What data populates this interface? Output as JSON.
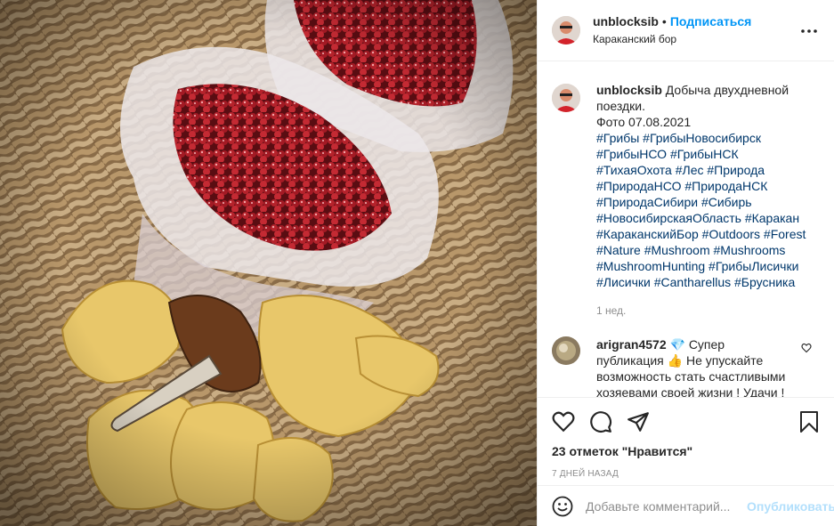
{
  "post": {
    "username": "unblocksib",
    "follow_label": "Подписаться",
    "separator": "•",
    "location": "Караканский бор",
    "more_label": "•••"
  },
  "caption": {
    "username": "unblocksib",
    "text_line1": "Добыча двухдневной",
    "text_line2": "поездки.",
    "text_line3": "Фото 07.08.2021",
    "hashtags": [
      "#Грибы #ГрибыНовосибирск",
      "#ГрибыНСО #ГрибыНСК",
      "#ТихаяОхота #Лес #Природа",
      "#ПриродаНСО #ПриродаНСК",
      "#ПриродаСибири #Сибирь",
      "#НовосибирскаяОбласть #Каракан",
      "#КараканскийБор #Outdoors #Forest",
      "#Nature #Mushroom #Mushrooms",
      "#MushroomHunting #ГрибыЛисички",
      "#Лисички #Cantharellus #Брусника"
    ],
    "time_ago": "1 нед."
  },
  "comment": {
    "username": "arigran4572",
    "text_line1": "💎 Супер",
    "text_line2": "публикация 👍 Не упускайте",
    "text_line3": "возможность стать счастливыми",
    "text_line4": "хозяевами своей жизни ! Удачи !"
  },
  "actions": {
    "likes_text": "23 отметок \"Нравится\"",
    "date_text": "7 дней назад"
  },
  "add_comment": {
    "placeholder": "Добавьте комментарий...",
    "publish_label": "Опубликовать"
  },
  "colors": {
    "link_blue": "#0095f6",
    "hashtag_blue": "#00376b",
    "muted_gray": "#8e8e8e",
    "publish_disabled": "#b2dffc"
  },
  "icons": [
    "more-icon",
    "heart-icon",
    "comment-icon",
    "share-icon",
    "bookmark-icon",
    "emoji-icon",
    "small-heart-icon"
  ]
}
